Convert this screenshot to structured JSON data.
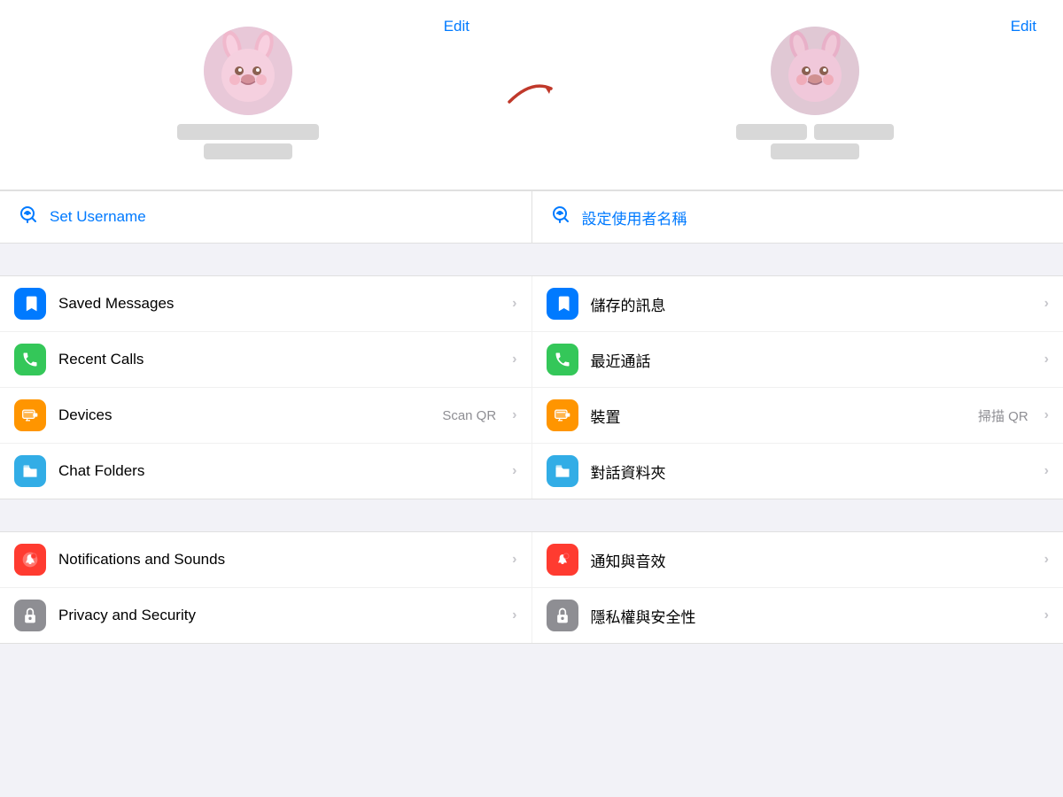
{
  "colors": {
    "accent": "#007aff",
    "background": "#f2f2f7",
    "white": "#ffffff"
  },
  "left": {
    "edit_label": "Edit",
    "username_icon": "👤",
    "username_label": "Set Username",
    "items": [
      {
        "icon": "🔖",
        "icon_class": "icon-blue",
        "label": "Saved Messages",
        "sublabel": "",
        "chevron": "›"
      },
      {
        "icon": "📞",
        "icon_class": "icon-green",
        "label": "Recent Calls",
        "sublabel": "",
        "chevron": "›"
      },
      {
        "icon": "💻",
        "icon_class": "icon-orange",
        "label": "Devices",
        "sublabel": "Scan QR",
        "chevron": "›"
      },
      {
        "icon": "📁",
        "icon_class": "icon-teal",
        "label": "Chat Folders",
        "sublabel": "",
        "chevron": "›"
      }
    ],
    "items2": [
      {
        "icon": "🔔",
        "icon_class": "icon-red",
        "label": "Notifications and Sounds",
        "sublabel": "",
        "chevron": "›"
      },
      {
        "icon": "🔒",
        "icon_class": "icon-gray",
        "label": "Privacy and Security",
        "sublabel": "",
        "chevron": "›"
      }
    ]
  },
  "right": {
    "edit_label": "Edit",
    "username_icon": "👤",
    "username_label": "設定使用者名稱",
    "items": [
      {
        "icon": "🔖",
        "icon_class": "icon-blue",
        "label": "儲存的訊息",
        "sublabel": "",
        "chevron": "›"
      },
      {
        "icon": "📞",
        "icon_class": "icon-green",
        "label": "最近通話",
        "sublabel": "",
        "chevron": "›"
      },
      {
        "icon": "💻",
        "icon_class": "icon-orange",
        "label": "裝置",
        "sublabel": "掃描 QR",
        "chevron": "›"
      },
      {
        "icon": "📁",
        "icon_class": "icon-teal",
        "label": "對話資料夾",
        "sublabel": "",
        "chevron": "›"
      }
    ],
    "items2": [
      {
        "icon": "🔔",
        "icon_class": "icon-red",
        "label": "通知與音效",
        "sublabel": "",
        "chevron": "›"
      },
      {
        "icon": "🔒",
        "icon_class": "icon-gray",
        "label": "隱私權與安全性",
        "sublabel": "",
        "chevron": "›"
      }
    ]
  }
}
